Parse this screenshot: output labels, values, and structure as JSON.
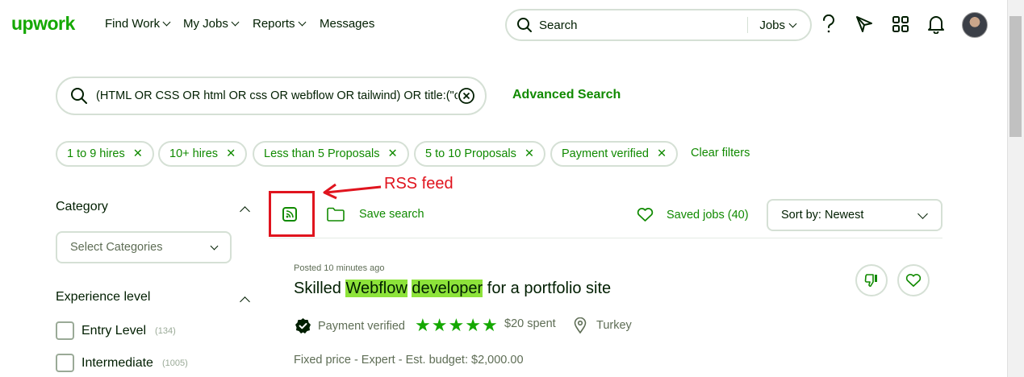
{
  "brand": {
    "logo_text": "upwork",
    "color": "#14a800",
    "link_color": "#108a00"
  },
  "nav": {
    "items": [
      {
        "label": "Find Work",
        "dropdown": true
      },
      {
        "label": "My Jobs",
        "dropdown": true
      },
      {
        "label": "Reports",
        "dropdown": true
      },
      {
        "label": "Messages",
        "dropdown": false
      }
    ],
    "search_placeholder": "Search",
    "search_scope": "Jobs",
    "icons": [
      "help-icon",
      "send-icon",
      "apps-grid-icon",
      "bell-icon",
      "avatar"
    ]
  },
  "search": {
    "query": "(HTML OR CSS OR html OR css OR webflow OR tailwind) OR title:(\"co...",
    "advanced_label": "Advanced Search"
  },
  "filters": {
    "chips": [
      "1 to 9 hires",
      "10+ hires",
      "Less than 5 Proposals",
      "5 to 10 Proposals",
      "Payment verified"
    ],
    "clear_label": "Clear filters"
  },
  "annotation": {
    "label": "RSS feed",
    "color": "#e0141e"
  },
  "toolbar": {
    "save_search_label": "Save search",
    "saved_jobs_label": "Saved jobs (40)",
    "sort_label": "Sort by: Newest"
  },
  "sidebar": {
    "category_title": "Category",
    "category_placeholder": "Select Categories",
    "experience_title": "Experience level",
    "experience_options": [
      {
        "label": "Entry Level",
        "count": "(134)"
      },
      {
        "label": "Intermediate",
        "count": "(1005)"
      }
    ]
  },
  "job": {
    "posted": "Posted 10 minutes ago",
    "title_pre": "Skilled ",
    "title_hl1": "Webflow",
    "title_mid": " ",
    "title_hl2": "developer",
    "title_post": " for a portfolio site",
    "payment": "Payment verified",
    "rating_stars": 5,
    "spent": "$20  spent",
    "location": "Turkey",
    "pricing": "Fixed price - Expert - Est. budget: $2,000.00",
    "highlight_color": "#8de33a"
  }
}
